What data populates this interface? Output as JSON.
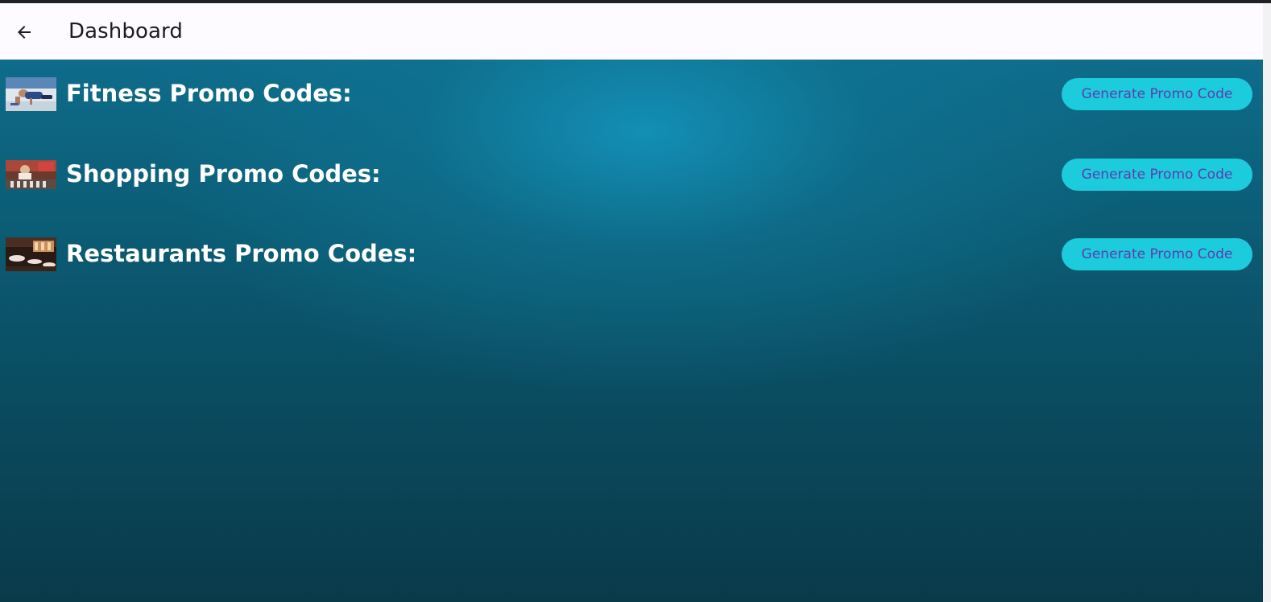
{
  "app_bar": {
    "title": "Dashboard",
    "back_icon": "arrow-back-icon"
  },
  "promo_sections": [
    {
      "label": "Fitness Promo Codes:",
      "thumbnail": "fitness-photo",
      "button_label": "Generate Promo Code"
    },
    {
      "label": "Shopping Promo Codes:",
      "thumbnail": "shopping-photo",
      "button_label": "Generate Promo Code"
    },
    {
      "label": "Restaurants Promo Codes:",
      "thumbnail": "restaurant-photo",
      "button_label": "Generate Promo Code"
    }
  ],
  "colors": {
    "app_bar_bg": "#fdfbff",
    "content_bg": "#0b5a72",
    "button_bg": "#1ccbdc",
    "button_text": "#5a3fb0",
    "label_text": "#ffffff"
  }
}
